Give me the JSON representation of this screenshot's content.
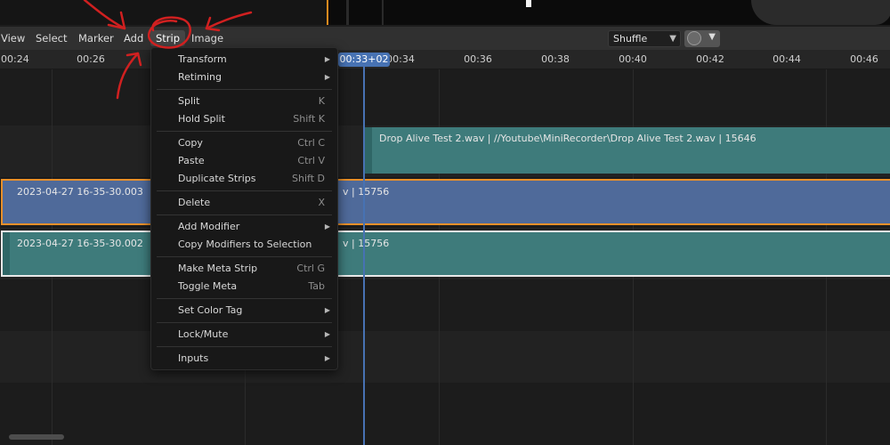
{
  "header": {
    "menus": [
      {
        "label": "View"
      },
      {
        "label": "Select"
      },
      {
        "label": "Marker"
      },
      {
        "label": "Add"
      },
      {
        "label": "Strip"
      },
      {
        "label": "Image"
      }
    ],
    "overlap_mode": "Shuffle",
    "snap_icon": "magnet-icon"
  },
  "ruler": {
    "ticks": [
      "00:24",
      "00:26",
      "00:34",
      "00:36",
      "00:38",
      "00:40",
      "00:42",
      "00:44",
      "00:46"
    ],
    "current_frame": "00:33+02"
  },
  "strips": [
    {
      "label": "Drop Alive Test 2.wav | //Youtube\\MiniRecorder\\Drop Alive Test 2.wav | 15646"
    },
    {
      "label": "2023-04-27 16-35-30.003",
      "suffix": "v | 15756"
    },
    {
      "label": "2023-04-27 16-35-30.002",
      "suffix": "v | 15756"
    }
  ],
  "strip_menu": {
    "items": [
      {
        "label": "Transform",
        "shortcut": "",
        "submenu": true
      },
      {
        "label": "Retiming",
        "shortcut": "",
        "submenu": true
      },
      {
        "label": "Split",
        "shortcut": "K",
        "submenu": false
      },
      {
        "label": "Hold Split",
        "shortcut": "Shift K",
        "submenu": false
      },
      {
        "label": "Copy",
        "shortcut": "Ctrl C",
        "submenu": false
      },
      {
        "label": "Paste",
        "shortcut": "Ctrl V",
        "submenu": false
      },
      {
        "label": "Duplicate Strips",
        "shortcut": "Shift D",
        "submenu": false
      },
      {
        "label": "Delete",
        "shortcut": "X",
        "submenu": false
      },
      {
        "label": "Add Modifier",
        "shortcut": "",
        "submenu": true
      },
      {
        "label": "Copy Modifiers to Selection",
        "shortcut": "",
        "submenu": false
      },
      {
        "label": "Make Meta Strip",
        "shortcut": "Ctrl G",
        "submenu": false
      },
      {
        "label": "Toggle Meta",
        "shortcut": "Tab",
        "submenu": false
      },
      {
        "label": "Set Color Tag",
        "shortcut": "",
        "submenu": true
      },
      {
        "label": "Lock/Mute",
        "shortcut": "",
        "submenu": true
      },
      {
        "label": "Inputs",
        "shortcut": "",
        "submenu": true
      }
    ]
  },
  "colors": {
    "playhead": "#4772b3",
    "selected_outline": "#e8902a",
    "sound_strip": "#3e7b7b",
    "movie_strip": "#4f6a9a",
    "annotation": "#d02020"
  }
}
